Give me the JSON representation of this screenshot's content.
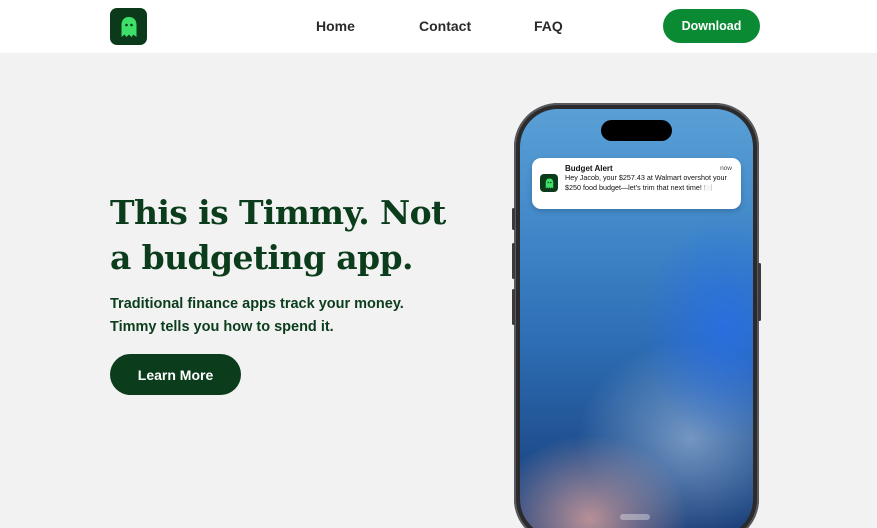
{
  "colors": {
    "brand_dark": "#0b3d1c",
    "brand_green": "#0a8a33",
    "ghost_green": "#3ee06a",
    "background": "#f2f2f2"
  },
  "header": {
    "logo_icon": "ghost-icon",
    "nav": {
      "home": "Home",
      "contact": "Contact",
      "faq": "FAQ"
    },
    "download_label": "Download"
  },
  "hero": {
    "title": "This is Timmy. Not a budgeting app.",
    "subtitle_line1": "Traditional finance apps track your money.",
    "subtitle_line2": "Timmy tells you how to spend it.",
    "cta_label": "Learn More"
  },
  "phone": {
    "notification": {
      "title": "Budget Alert",
      "time": "now",
      "body": "Hey Jacob, your $257.43 at Walmart overshot your $250 food budget—let's trim that next time! 🍽️",
      "icon": "ghost-icon"
    }
  }
}
